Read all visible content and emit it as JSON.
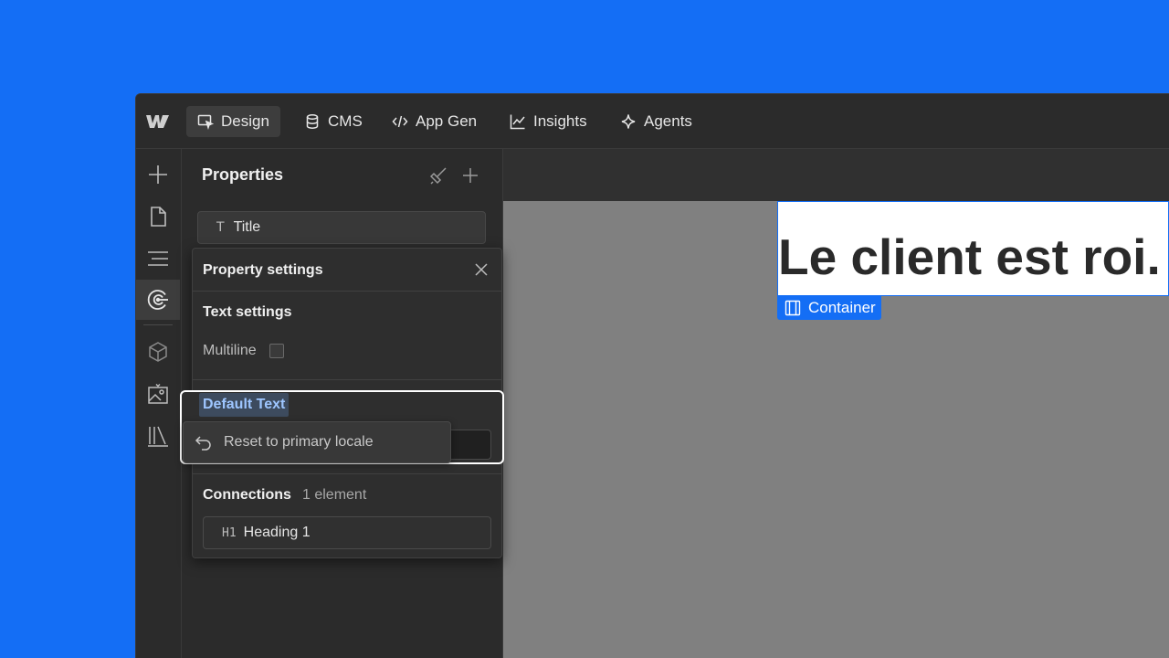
{
  "topbar": {
    "tabs": [
      {
        "label": "Design",
        "icon": "design-cursor-icon",
        "active": true
      },
      {
        "label": "CMS",
        "icon": "database-icon"
      },
      {
        "label": "App Gen",
        "icon": "code-icon"
      },
      {
        "label": "Insights",
        "icon": "chart-line-icon"
      },
      {
        "label": "Agents",
        "icon": "sparkle-icon"
      }
    ]
  },
  "rail": {
    "items": [
      "add-icon",
      "page-icon",
      "navigator-icon",
      "components-icon",
      "cube-icon",
      "assets-icon",
      "library-icon"
    ]
  },
  "panel": {
    "title": "Properties",
    "property_field": "Title"
  },
  "popover": {
    "title": "Property settings",
    "text_settings_title": "Text settings",
    "multiline_label": "Multiline",
    "default_text_label": "Default Text",
    "connections_title": "Connections",
    "connections_count": "1 element",
    "connection_item_icon": "H1",
    "connection_item_label": "Heading 1"
  },
  "context_menu": {
    "reset_label": "Reset to primary locale"
  },
  "canvas": {
    "heading": "Le client est roi.",
    "container_label": "Container"
  },
  "colors": {
    "accent": "#146ef5",
    "background": "#1e1e1e",
    "panel": "#2b2b2b"
  }
}
